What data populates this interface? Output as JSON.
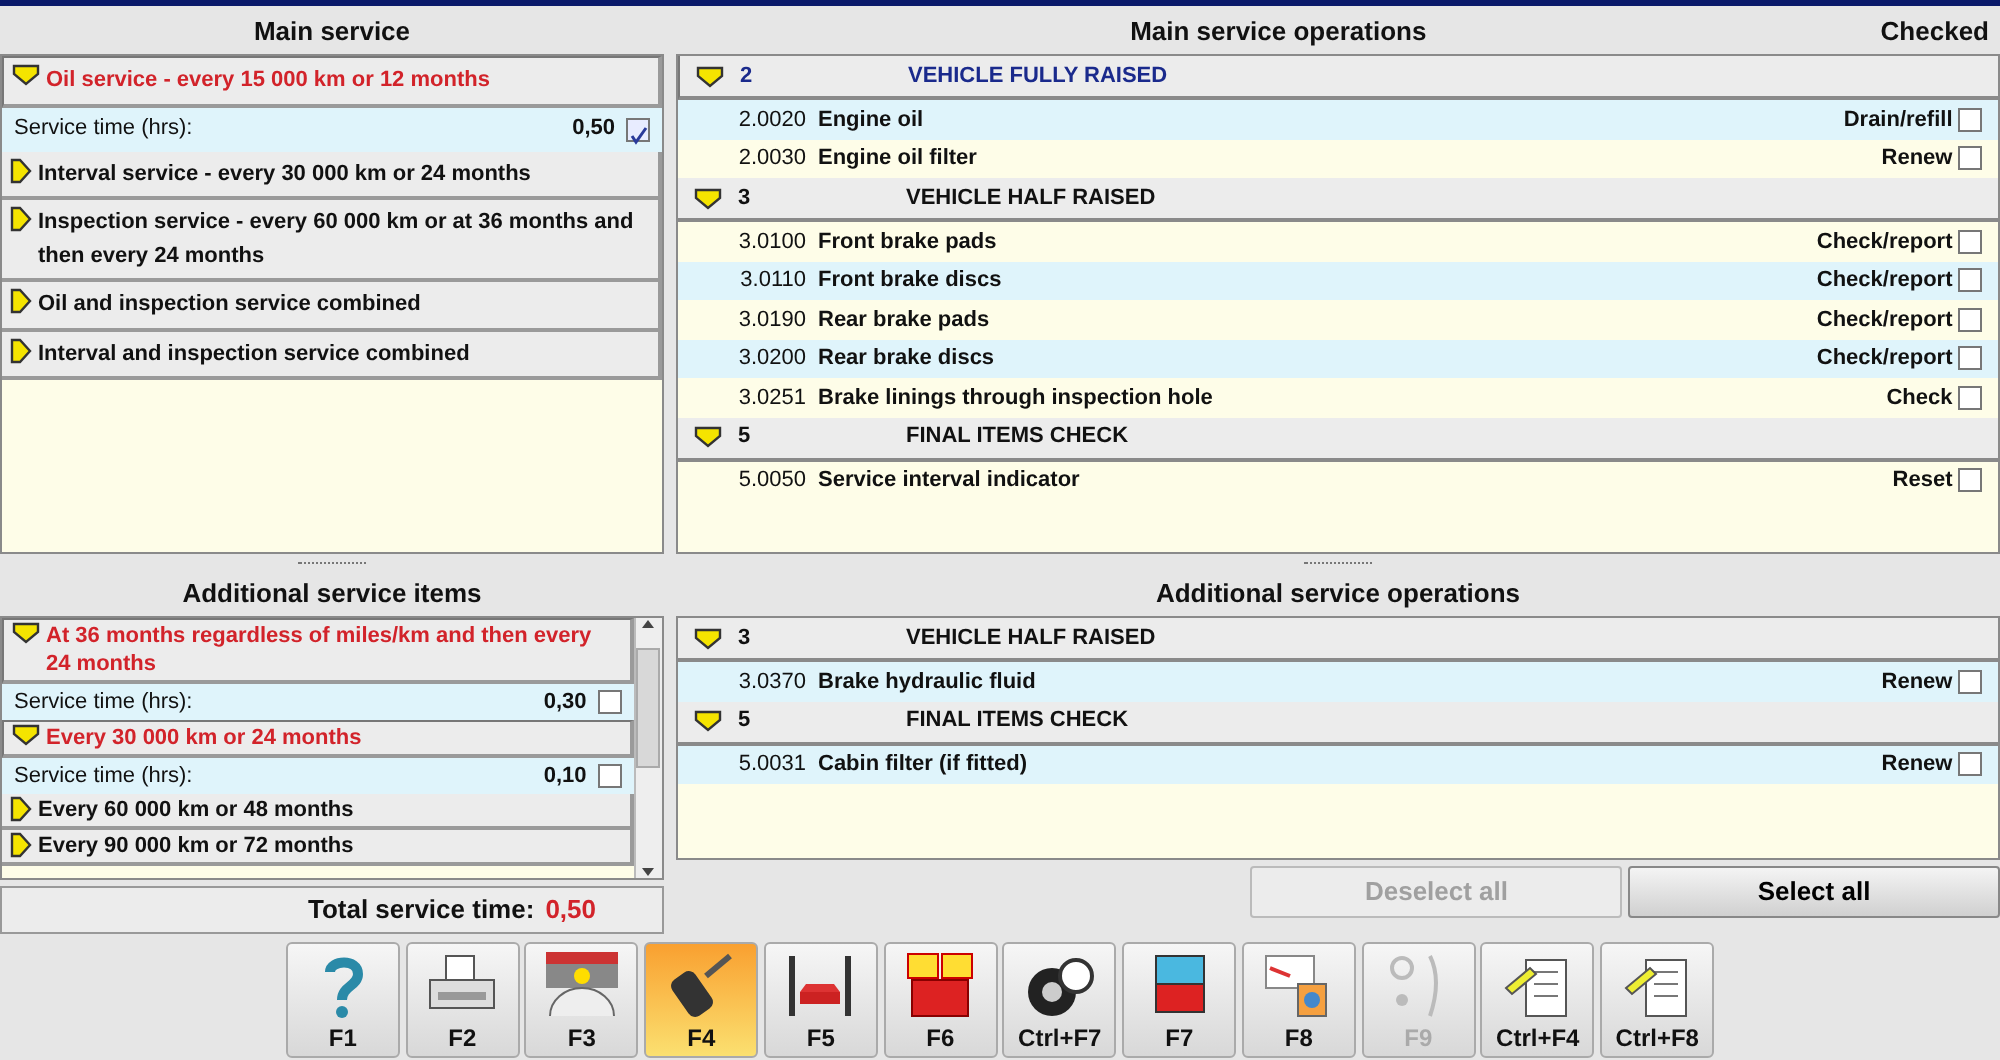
{
  "main_service": {
    "title": "Main service",
    "items": [
      {
        "label": "Oil service - every 15 000 km or 12 months",
        "selected": true,
        "service_time": {
          "label": "Service time (hrs):",
          "value": "0,50",
          "checked": true
        }
      },
      {
        "label": "Interval service - every 30 000 km or 24 months",
        "selected": false
      },
      {
        "label": "Inspection service - every 60 000 km or at 36 months and then every 24 months",
        "selected": false
      },
      {
        "label": "Oil and inspection service combined",
        "selected": false
      },
      {
        "label": "Interval and inspection service combined",
        "selected": false
      }
    ]
  },
  "additional_items": {
    "title": "Additional service items",
    "items": [
      {
        "label": "At 36 months regardless of miles/km and then every 24 months",
        "selected": true,
        "service_time": {
          "label": "Service time (hrs):",
          "value": "0,30",
          "checked": false
        }
      },
      {
        "label": "Every 30 000 km or 24 months",
        "selected": true,
        "service_time": {
          "label": "Service time (hrs):",
          "value": "0,10",
          "checked": false
        }
      },
      {
        "label": "Every 60 000 km or 48 months",
        "selected": false
      },
      {
        "label": "Every 90 000 km or 72 months",
        "selected": false
      }
    ]
  },
  "total": {
    "label": "Total service time:",
    "value": "0,50"
  },
  "main_operations": {
    "title": "Main service operations",
    "checked_heading": "Checked",
    "groups": [
      {
        "number": "2",
        "title": "VEHICLE FULLY RAISED",
        "selected": true,
        "operations": [
          {
            "code": "2.0020",
            "name": "Engine oil",
            "action": "Drain/refill",
            "selected": true,
            "checked": false
          },
          {
            "code": "2.0030",
            "name": "Engine oil filter",
            "action": "Renew",
            "selected": false,
            "checked": false
          }
        ]
      },
      {
        "number": "3",
        "title": "VEHICLE HALF RAISED",
        "selected": false,
        "operations": [
          {
            "code": "3.0100",
            "name": "Front brake pads",
            "action": "Check/report",
            "selected": false,
            "checked": false
          },
          {
            "code": "3.0110",
            "name": "Front brake discs",
            "action": "Check/report",
            "selected": true,
            "checked": false
          },
          {
            "code": "3.0190",
            "name": "Rear brake pads",
            "action": "Check/report",
            "selected": false,
            "checked": false
          },
          {
            "code": "3.0200",
            "name": "Rear brake discs",
            "action": "Check/report",
            "selected": true,
            "checked": false
          },
          {
            "code": "3.0251",
            "name": "Brake linings through inspection hole",
            "action": "Check",
            "selected": false,
            "checked": false
          }
        ]
      },
      {
        "number": "5",
        "title": "FINAL ITEMS CHECK",
        "selected": false,
        "operations": [
          {
            "code": "5.0050",
            "name": "Service interval indicator",
            "action": "Reset",
            "selected": false,
            "checked": false
          }
        ]
      }
    ]
  },
  "additional_operations": {
    "title": "Additional service operations",
    "groups": [
      {
        "number": "3",
        "title": "VEHICLE HALF RAISED",
        "selected": false,
        "operations": [
          {
            "code": "3.0370",
            "name": "Brake hydraulic fluid",
            "action": "Renew",
            "selected": true,
            "checked": false
          }
        ]
      },
      {
        "number": "5",
        "title": "FINAL ITEMS CHECK",
        "selected": false,
        "operations": [
          {
            "code": "5.0031",
            "name": "Cabin filter (if fitted)",
            "action": "Renew",
            "selected": true,
            "checked": false
          }
        ]
      }
    ]
  },
  "buttons": [
    {
      "label": "Deselect all",
      "disabled": true
    },
    {
      "label": "Select all",
      "disabled": false
    }
  ],
  "toolbar": [
    {
      "key": "F1",
      "selected": false,
      "disabled": false
    },
    {
      "key": "F2",
      "selected": false,
      "disabled": false
    },
    {
      "key": "F3",
      "selected": false,
      "disabled": false
    },
    {
      "key": "F4",
      "selected": true,
      "disabled": false
    },
    {
      "key": "F5",
      "selected": false,
      "disabled": false
    },
    {
      "key": "F6",
      "selected": false,
      "disabled": false
    },
    {
      "key": "Ctrl+F7",
      "selected": false,
      "disabled": false
    },
    {
      "key": "F7",
      "selected": false,
      "disabled": false
    },
    {
      "key": "F8",
      "selected": false,
      "disabled": false
    },
    {
      "key": "F9",
      "selected": false,
      "disabled": true
    },
    {
      "key": "Ctrl+F4",
      "selected": false,
      "disabled": false
    },
    {
      "key": "Ctrl+F8",
      "selected": false,
      "disabled": false
    }
  ]
}
